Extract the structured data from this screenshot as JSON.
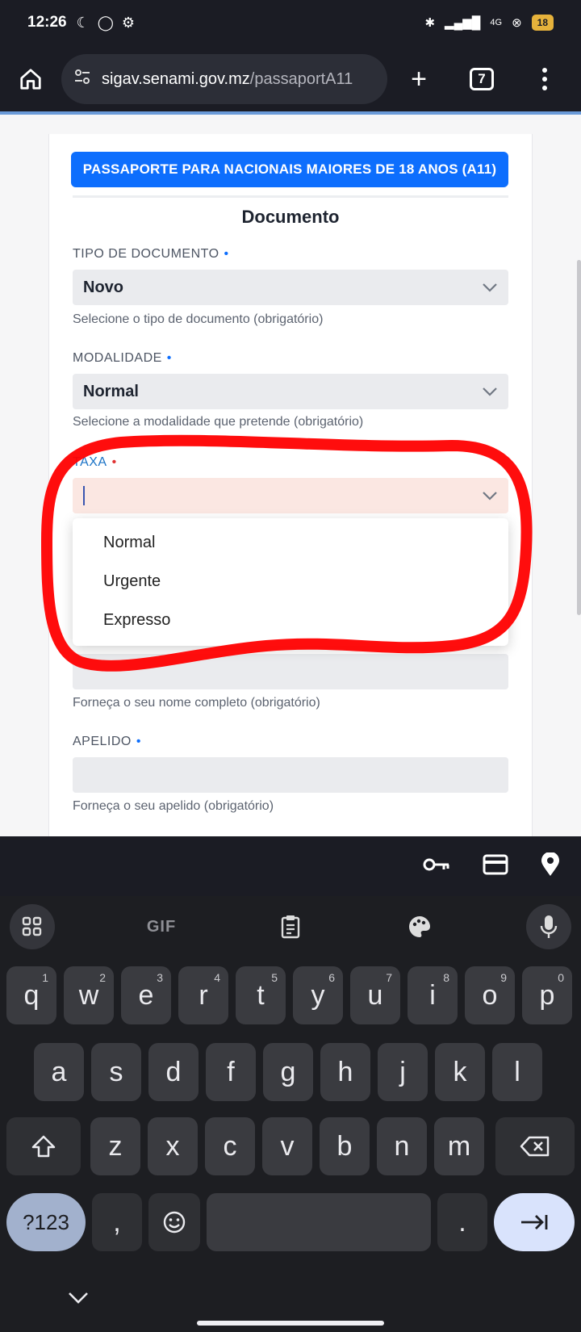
{
  "status_bar": {
    "time": "12:26",
    "battery": "18",
    "network": "4G"
  },
  "browser": {
    "url_domain": "sigav.senami.gov.mz",
    "url_path": "/passaportA11",
    "tab_count": "7"
  },
  "form": {
    "title_button": "PASSAPORTE PARA NACIONAIS MAIORES DE 18 ANOS (A11)",
    "section_title": "Documento",
    "fields": [
      {
        "label": "TIPO DE DOCUMENTO",
        "value": "Novo",
        "help": "Selecione o tipo de documento (obrigatório)"
      },
      {
        "label": "MODALIDADE",
        "value": "Normal",
        "help": "Selecione a modalidade que pretende (obrigatório)"
      },
      {
        "label": "TAXA",
        "value": "",
        "help": ""
      },
      {
        "label": "",
        "value": "",
        "help": "Forneça o seu nome completo (obrigatório)"
      },
      {
        "label": "APELIDO",
        "value": "",
        "help": "Forneça o seu apelido (obrigatório)"
      }
    ],
    "required_mark": "•",
    "taxa_options": [
      "Normal",
      "Urgente",
      "Expresso"
    ]
  },
  "annotation": {
    "color": "#ff0000"
  },
  "keyboard": {
    "gif_label": "GIF",
    "row1": [
      [
        "q",
        "1"
      ],
      [
        "w",
        "2"
      ],
      [
        "e",
        "3"
      ],
      [
        "r",
        "4"
      ],
      [
        "t",
        "5"
      ],
      [
        "y",
        "6"
      ],
      [
        "u",
        "7"
      ],
      [
        "i",
        "8"
      ],
      [
        "o",
        "9"
      ],
      [
        "p",
        "0"
      ]
    ],
    "row2": [
      "a",
      "s",
      "d",
      "f",
      "g",
      "h",
      "j",
      "k",
      "l"
    ],
    "row3": [
      "z",
      "x",
      "c",
      "v",
      "b",
      "n",
      "m"
    ],
    "symbols_label": "?123",
    "comma": ",",
    "period": "."
  }
}
